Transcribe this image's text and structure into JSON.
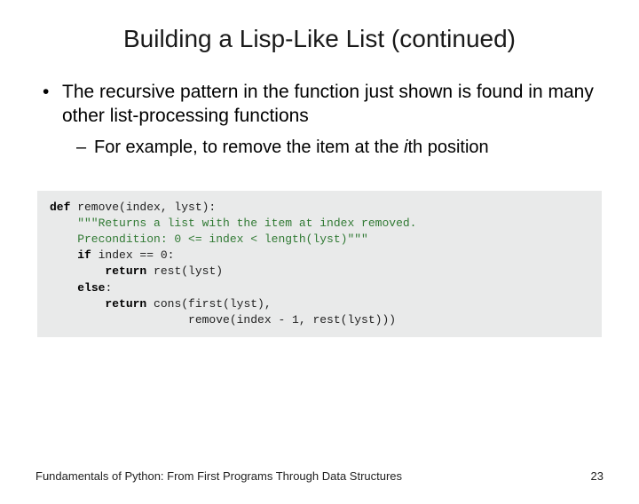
{
  "title": "Building a Lisp-Like List (continued)",
  "bullet1": "The recursive pattern in the function just shown is found in many other list-processing functions",
  "bullet2_pre": "For example, to remove the item at the ",
  "bullet2_ital": "i",
  "bullet2_post": "th position",
  "code": {
    "l1a": "def",
    "l1b": " remove(index, lyst):",
    "l2": "    \"\"\"Returns a list with the item at index removed.",
    "l3": "    Precondition: 0 <= index < length(lyst)\"\"\"",
    "l4a": "    ",
    "l4b": "if",
    "l4c": " index == 0:",
    "l5a": "        ",
    "l5b": "return",
    "l5c": " rest(lyst)",
    "l6a": "    ",
    "l6b": "else",
    "l6c": ":",
    "l7a": "        ",
    "l7b": "return",
    "l7c": " cons(first(lyst),",
    "l8": "                    remove(index - 1, rest(lyst)))"
  },
  "footer_left": "Fundamentals of Python: From First Programs Through Data Structures",
  "footer_right": "23"
}
